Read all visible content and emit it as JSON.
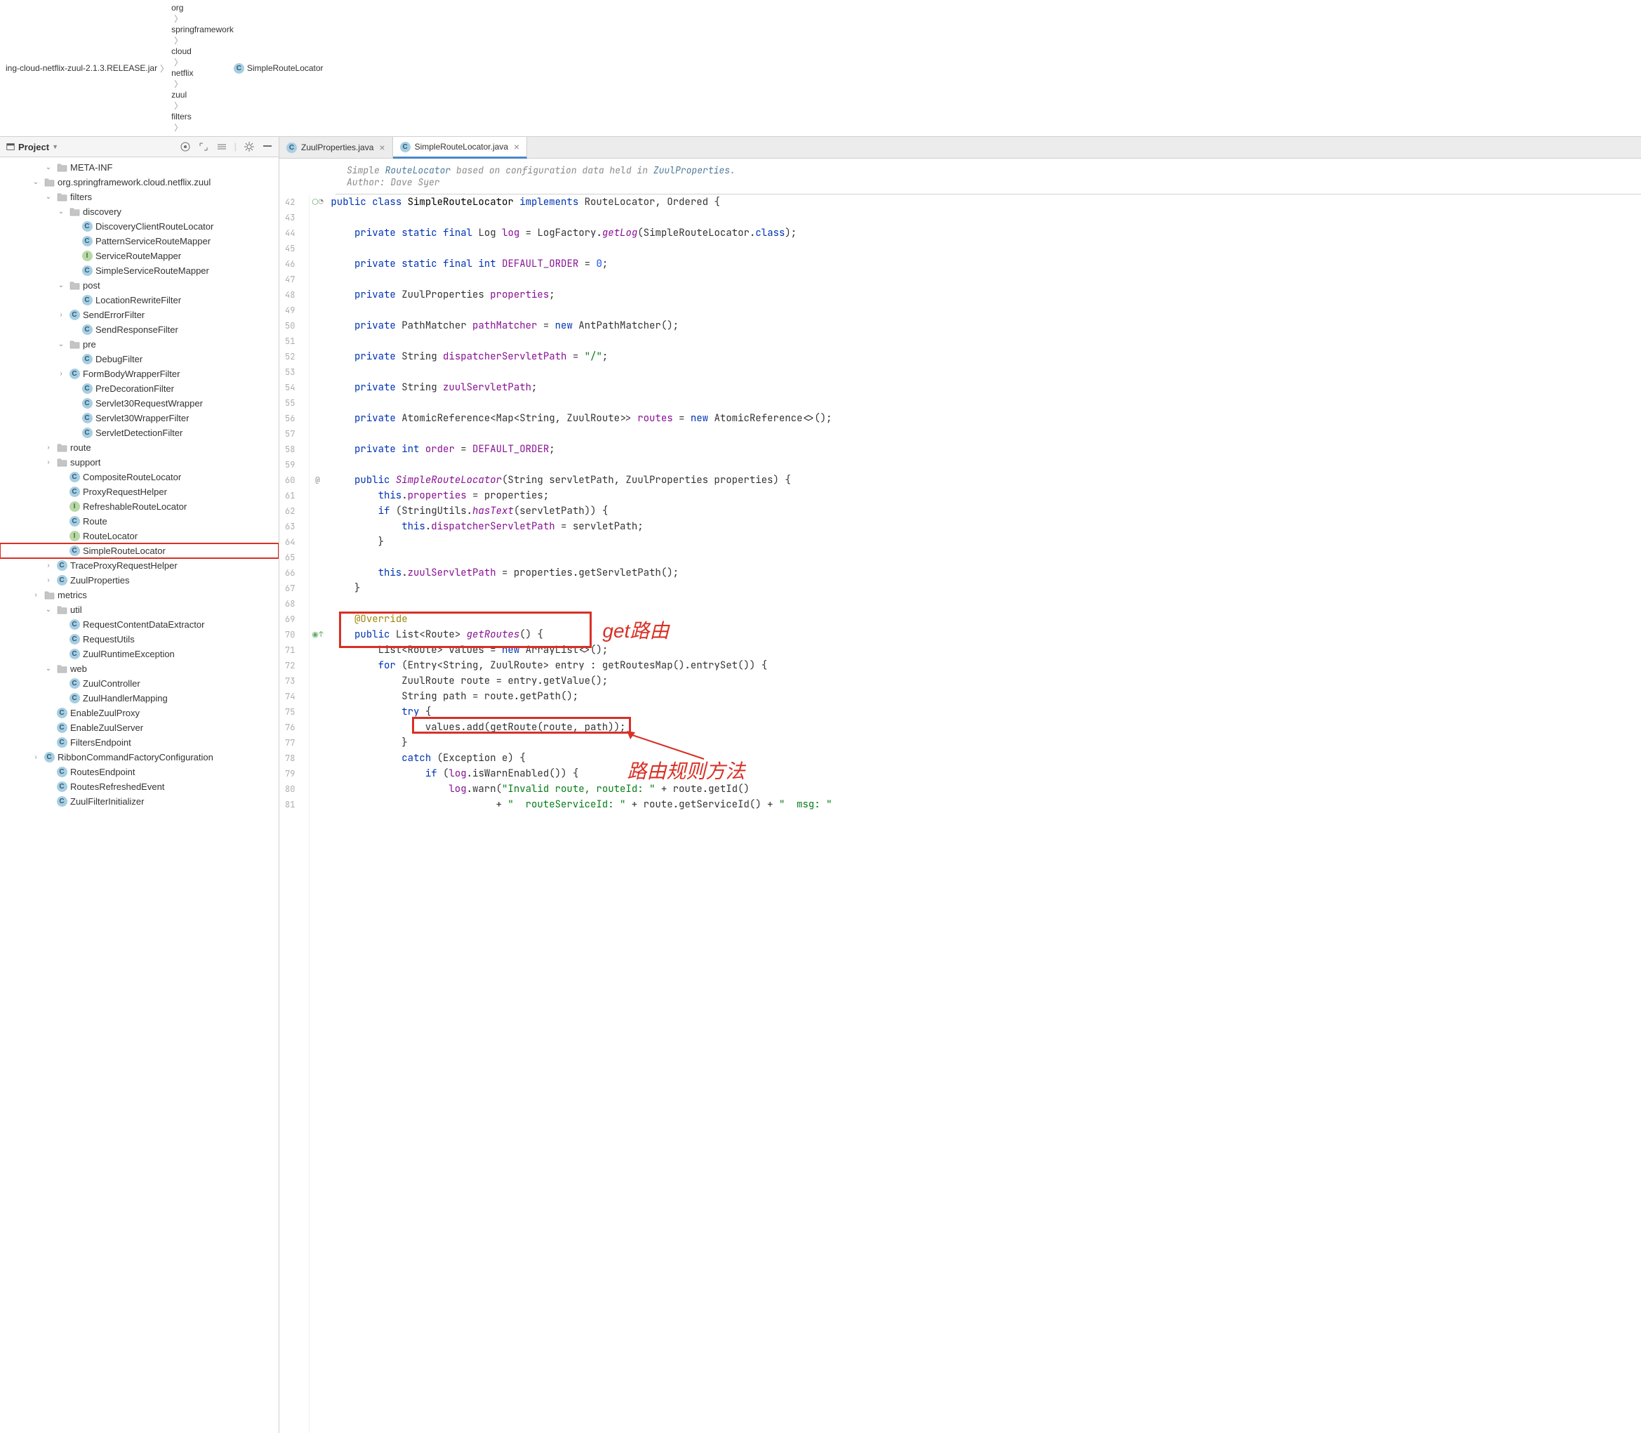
{
  "breadcrumb": {
    "jar": "ing-cloud-netflix-zuul-2.1.3.RELEASE.jar",
    "items": [
      "org",
      "springframework",
      "cloud",
      "netflix",
      "zuul",
      "filters"
    ],
    "file": "SimpleRouteLocator"
  },
  "sidebar": {
    "title": "Project",
    "tree": [
      {
        "indent": 3,
        "chev": "v",
        "icon": "folder",
        "label": "META-INF"
      },
      {
        "indent": 2,
        "chev": "v",
        "icon": "folder",
        "label": "org.springframework.cloud.netflix.zuul"
      },
      {
        "indent": 3,
        "chev": "v",
        "icon": "folder",
        "label": "filters"
      },
      {
        "indent": 4,
        "chev": "v",
        "icon": "folder",
        "label": "discovery"
      },
      {
        "indent": 5,
        "chev": "",
        "icon": "class",
        "label": "DiscoveryClientRouteLocator"
      },
      {
        "indent": 5,
        "chev": "",
        "icon": "class",
        "label": "PatternServiceRouteMapper"
      },
      {
        "indent": 5,
        "chev": "",
        "icon": "interface",
        "label": "ServiceRouteMapper"
      },
      {
        "indent": 5,
        "chev": "",
        "icon": "class",
        "label": "SimpleServiceRouteMapper"
      },
      {
        "indent": 4,
        "chev": "v",
        "icon": "folder",
        "label": "post"
      },
      {
        "indent": 5,
        "chev": "",
        "icon": "class",
        "label": "LocationRewriteFilter"
      },
      {
        "indent": 4,
        "chev": ">",
        "icon": "class",
        "label": "SendErrorFilter"
      },
      {
        "indent": 5,
        "chev": "",
        "icon": "class",
        "label": "SendResponseFilter"
      },
      {
        "indent": 4,
        "chev": "v",
        "icon": "folder",
        "label": "pre"
      },
      {
        "indent": 5,
        "chev": "",
        "icon": "class",
        "label": "DebugFilter"
      },
      {
        "indent": 4,
        "chev": ">",
        "icon": "class",
        "label": "FormBodyWrapperFilter"
      },
      {
        "indent": 5,
        "chev": "",
        "icon": "class",
        "label": "PreDecorationFilter"
      },
      {
        "indent": 5,
        "chev": "",
        "icon": "class",
        "label": "Servlet30RequestWrapper"
      },
      {
        "indent": 5,
        "chev": "",
        "icon": "class",
        "label": "Servlet30WrapperFilter"
      },
      {
        "indent": 5,
        "chev": "",
        "icon": "class",
        "label": "ServletDetectionFilter"
      },
      {
        "indent": 3,
        "chev": ">",
        "icon": "folder",
        "label": "route"
      },
      {
        "indent": 3,
        "chev": ">",
        "icon": "folder",
        "label": "support"
      },
      {
        "indent": 4,
        "chev": "",
        "icon": "class",
        "label": "CompositeRouteLocator"
      },
      {
        "indent": 4,
        "chev": "",
        "icon": "class",
        "label": "ProxyRequestHelper"
      },
      {
        "indent": 4,
        "chev": "",
        "icon": "interface",
        "label": "RefreshableRouteLocator"
      },
      {
        "indent": 4,
        "chev": "",
        "icon": "class",
        "label": "Route"
      },
      {
        "indent": 4,
        "chev": "",
        "icon": "interface",
        "label": "RouteLocator"
      },
      {
        "indent": 4,
        "chev": "",
        "icon": "class",
        "label": "SimpleRouteLocator",
        "highlighted": true
      },
      {
        "indent": 3,
        "chev": ">",
        "icon": "class",
        "label": "TraceProxyRequestHelper"
      },
      {
        "indent": 3,
        "chev": ">",
        "icon": "class",
        "label": "ZuulProperties"
      },
      {
        "indent": 2,
        "chev": ">",
        "icon": "folder",
        "label": "metrics"
      },
      {
        "indent": 3,
        "chev": "v",
        "icon": "folder",
        "label": "util"
      },
      {
        "indent": 4,
        "chev": "",
        "icon": "class",
        "label": "RequestContentDataExtractor"
      },
      {
        "indent": 4,
        "chev": "",
        "icon": "class",
        "label": "RequestUtils"
      },
      {
        "indent": 4,
        "chev": "",
        "icon": "class",
        "label": "ZuulRuntimeException"
      },
      {
        "indent": 3,
        "chev": "v",
        "icon": "folder",
        "label": "web"
      },
      {
        "indent": 4,
        "chev": "",
        "icon": "class",
        "label": "ZuulController"
      },
      {
        "indent": 4,
        "chev": "",
        "icon": "class",
        "label": "ZuulHandlerMapping"
      },
      {
        "indent": 3,
        "chev": "",
        "icon": "class",
        "label": "EnableZuulProxy"
      },
      {
        "indent": 3,
        "chev": "",
        "icon": "class",
        "label": "EnableZuulServer"
      },
      {
        "indent": 3,
        "chev": "",
        "icon": "class",
        "label": "FiltersEndpoint"
      },
      {
        "indent": 2,
        "chev": ">",
        "icon": "class",
        "label": "RibbonCommandFactoryConfiguration"
      },
      {
        "indent": 3,
        "chev": "",
        "icon": "class",
        "label": "RoutesEndpoint"
      },
      {
        "indent": 3,
        "chev": "",
        "icon": "class",
        "label": "RoutesRefreshedEvent"
      },
      {
        "indent": 3,
        "chev": "",
        "icon": "class",
        "label": "ZuulFilterInitializer"
      }
    ]
  },
  "tabs": [
    {
      "label": "ZuulProperties.java",
      "active": false
    },
    {
      "label": "SimpleRouteLocator.java",
      "active": true
    }
  ],
  "doc": {
    "line1_pre": "Simple ",
    "line1_link1": "RouteLocator",
    "line1_mid": " based on configuration data held in ",
    "line1_link2": "ZuulProperties",
    "line1_post": ".",
    "line2": "Author: Dave Syer"
  },
  "gutter": {
    "start": 42,
    "end": 81
  },
  "annotations": {
    "get_route": "get路由",
    "route_rule": "路由规则方法"
  },
  "code_lines": [
    {
      "n": 42,
      "html": "<span class='kw'>public</span> <span class='kw'>class</span> <span class='cls'>SimpleRouteLocator</span> <span class='kw'>implements</span> RouteLocator, Ordered {"
    },
    {
      "n": 43,
      "html": ""
    },
    {
      "n": 44,
      "html": "    <span class='kw'>private</span> <span class='kw'>static</span> <span class='kw'>final</span> Log <span class='fld'>log</span> = LogFactory.<span class='fn'>getLog</span>(SimpleRouteLocator.<span class='kw'>class</span>);"
    },
    {
      "n": 45,
      "html": ""
    },
    {
      "n": 46,
      "html": "    <span class='kw'>private</span> <span class='kw'>static</span> <span class='kw'>final</span> <span class='kw'>int</span> <span class='fld'>DEFAULT_ORDER</span> = <span class='num'>0</span>;"
    },
    {
      "n": 47,
      "html": ""
    },
    {
      "n": 48,
      "html": "    <span class='kw'>private</span> ZuulProperties <span class='fld'>properties</span>;"
    },
    {
      "n": 49,
      "html": ""
    },
    {
      "n": 50,
      "html": "    <span class='kw'>private</span> PathMatcher <span class='fld'>pathMatcher</span> = <span class='kw'>new</span> AntPathMatcher();"
    },
    {
      "n": 51,
      "html": ""
    },
    {
      "n": 52,
      "html": "    <span class='kw'>private</span> String <span class='fld'>dispatcherServletPath</span> = <span class='str'>\"/\"</span>;"
    },
    {
      "n": 53,
      "html": ""
    },
    {
      "n": 54,
      "html": "    <span class='kw'>private</span> String <span class='fld'>zuulServletPath</span>;"
    },
    {
      "n": 55,
      "html": ""
    },
    {
      "n": 56,
      "html": "    <span class='kw'>private</span> AtomicReference&lt;Map&lt;String, ZuulRoute&gt;&gt; <span class='fld'>routes</span> = <span class='kw'>new</span> AtomicReference&lt;&gt;();"
    },
    {
      "n": 57,
      "html": ""
    },
    {
      "n": 58,
      "html": "    <span class='kw'>private</span> <span class='kw'>int</span> <span class='fld'>order</span> = <span class='fld'>DEFAULT_ORDER</span>;"
    },
    {
      "n": 59,
      "html": ""
    },
    {
      "n": 60,
      "html": "    <span class='kw'>public</span> <span class='fn'>SimpleRouteLocator</span>(String servletPath, ZuulProperties properties) {"
    },
    {
      "n": 61,
      "html": "        <span class='kw'>this</span>.<span class='fld'>properties</span> = properties;"
    },
    {
      "n": 62,
      "html": "        <span class='kw'>if</span> (StringUtils.<span class='fn'>hasText</span>(servletPath)) {"
    },
    {
      "n": 63,
      "html": "            <span class='kw'>this</span>.<span class='fld'>dispatcherServletPath</span> = servletPath;"
    },
    {
      "n": 64,
      "html": "        }"
    },
    {
      "n": 65,
      "html": ""
    },
    {
      "n": 66,
      "html": "        <span class='kw'>this</span>.<span class='fld'>zuulServletPath</span> = properties.getServletPath();"
    },
    {
      "n": 67,
      "html": "    }"
    },
    {
      "n": 68,
      "html": ""
    },
    {
      "n": 69,
      "html": "    <span class='ann'>@Override</span>"
    },
    {
      "n": 70,
      "html": "    <span class='kw'>public</span> List&lt;Route&gt; <span class='fn'>getRoutes</span>() {"
    },
    {
      "n": 71,
      "html": "        List&lt;Route&gt; values = <span class='kw'>new</span> ArrayList&lt;&gt;();"
    },
    {
      "n": 72,
      "html": "        <span class='kw'>for</span> (Entry&lt;String, ZuulRoute&gt; entry : getRoutesMap().entrySet()) {"
    },
    {
      "n": 73,
      "html": "            ZuulRoute route = entry.getValue();"
    },
    {
      "n": 74,
      "html": "            String path = route.getPath();"
    },
    {
      "n": 75,
      "html": "            <span class='kw'>try</span> {"
    },
    {
      "n": 76,
      "html": "                values.add(getRoute(route, path));"
    },
    {
      "n": 77,
      "html": "            }"
    },
    {
      "n": 78,
      "html": "            <span class='kw'>catch</span> (Exception e) {"
    },
    {
      "n": 79,
      "html": "                <span class='kw'>if</span> (<span class='fld'>log</span>.isWarnEnabled()) {"
    },
    {
      "n": 80,
      "html": "                    <span class='fld'>log</span>.warn(<span class='str'>\"Invalid route, routeId: \"</span> + route.getId()"
    },
    {
      "n": 81,
      "html": "                            + <span class='str'>\"  routeServiceId: \"</span> + route.getServiceId() + <span class='str'>\"  msg: \"</span>"
    }
  ]
}
